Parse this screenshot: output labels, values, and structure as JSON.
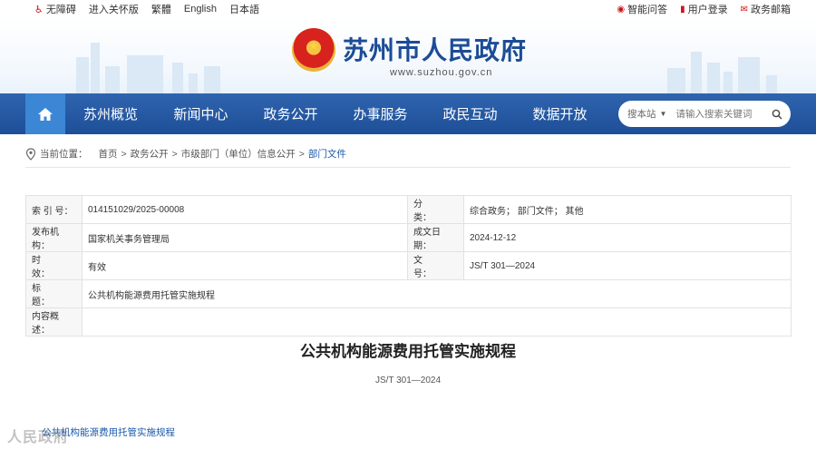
{
  "topbar": {
    "left": [
      "无障碍",
      "进入关怀版",
      "繁體",
      "English",
      "日本語"
    ],
    "right": [
      "智能问答",
      "用户登录",
      "政务邮箱"
    ]
  },
  "header": {
    "title": "苏州市人民政府",
    "url": "www.suzhou.gov.cn"
  },
  "nav": {
    "items": [
      "苏州概览",
      "新闻中心",
      "政务公开",
      "办事服务",
      "政民互动",
      "数据开放"
    ]
  },
  "search": {
    "scope": "搜本站",
    "placeholder": "请输入搜索关键词"
  },
  "breadcrumb": {
    "prefix": "当前位置：",
    "items": [
      "首页",
      "政务公开",
      "市级部门（单位）信息公开",
      "部门文件"
    ],
    "sep": ">"
  },
  "meta": {
    "index_label": "索 引 号：",
    "index_value": "014151029/2025-00008",
    "category_label": "分　　类：",
    "category_value": "综合政务； 部门文件； 其他",
    "publisher_label": "发布机构：",
    "publisher_value": "国家机关事务管理局",
    "date_label": "成文日期：",
    "date_value": "2024-12-12",
    "validity_label": "时　　效：",
    "validity_value": "有效",
    "docno_label": "文　　号：",
    "docno_value": "JS/T 301—2024",
    "title_label": "标　　题：",
    "title_value": "公共机构能源费用托管实施规程",
    "summary_label": "内容概述：",
    "summary_value": ""
  },
  "document": {
    "title": "公共机构能源费用托管实施规程",
    "code": "JS/T 301—2024"
  },
  "attachment": {
    "link": "公共机构能源费用托管实施规程"
  },
  "watermark": "人民政府"
}
